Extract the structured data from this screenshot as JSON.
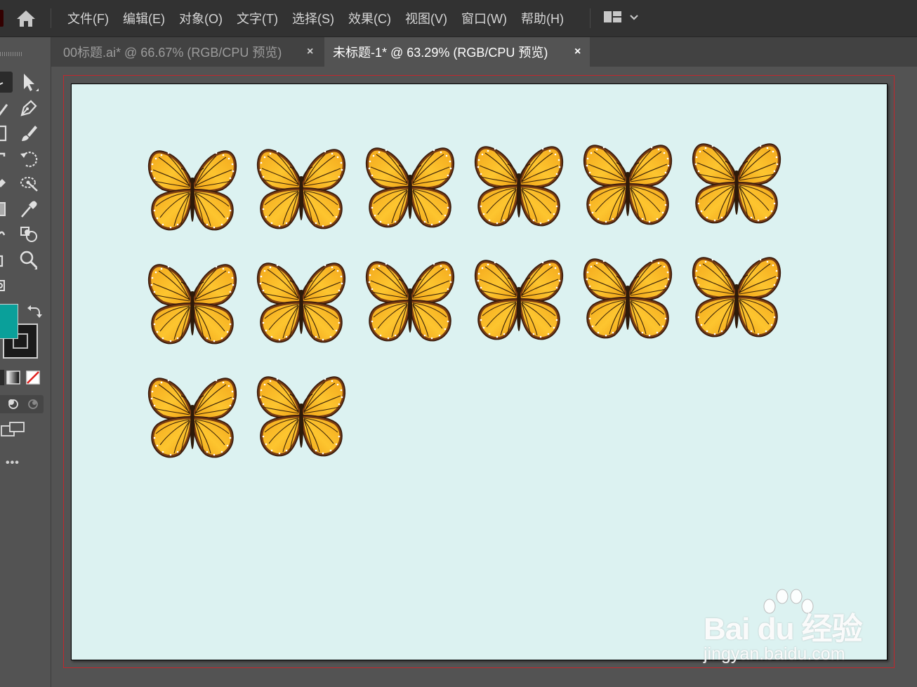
{
  "menubar": {
    "items": [
      "文件(F)",
      "编辑(E)",
      "对象(O)",
      "文字(T)",
      "选择(S)",
      "效果(C)",
      "视图(V)",
      "窗口(W)",
      "帮助(H)"
    ]
  },
  "tabs": [
    {
      "label": "00标题.ai* @ 66.67% (RGB/CPU 预览)",
      "close": "×",
      "active": false
    },
    {
      "label": "未标题-1* @ 63.29% (RGB/CPU 预览)",
      "close": "×",
      "active": true
    }
  ],
  "toolbar": {
    "fill_color": "#0aa09a",
    "stroke_color": "#1a1a1a",
    "more_label": "•••"
  },
  "canvas": {
    "artboard_color": "#dcf2f1",
    "bleed_color": "#c1272d",
    "butterfly_count": 14,
    "butterfly_rows": [
      6,
      6,
      2
    ]
  },
  "watermark": {
    "brand": "Bai du 经验",
    "url": "jingyan.baidu.com"
  }
}
